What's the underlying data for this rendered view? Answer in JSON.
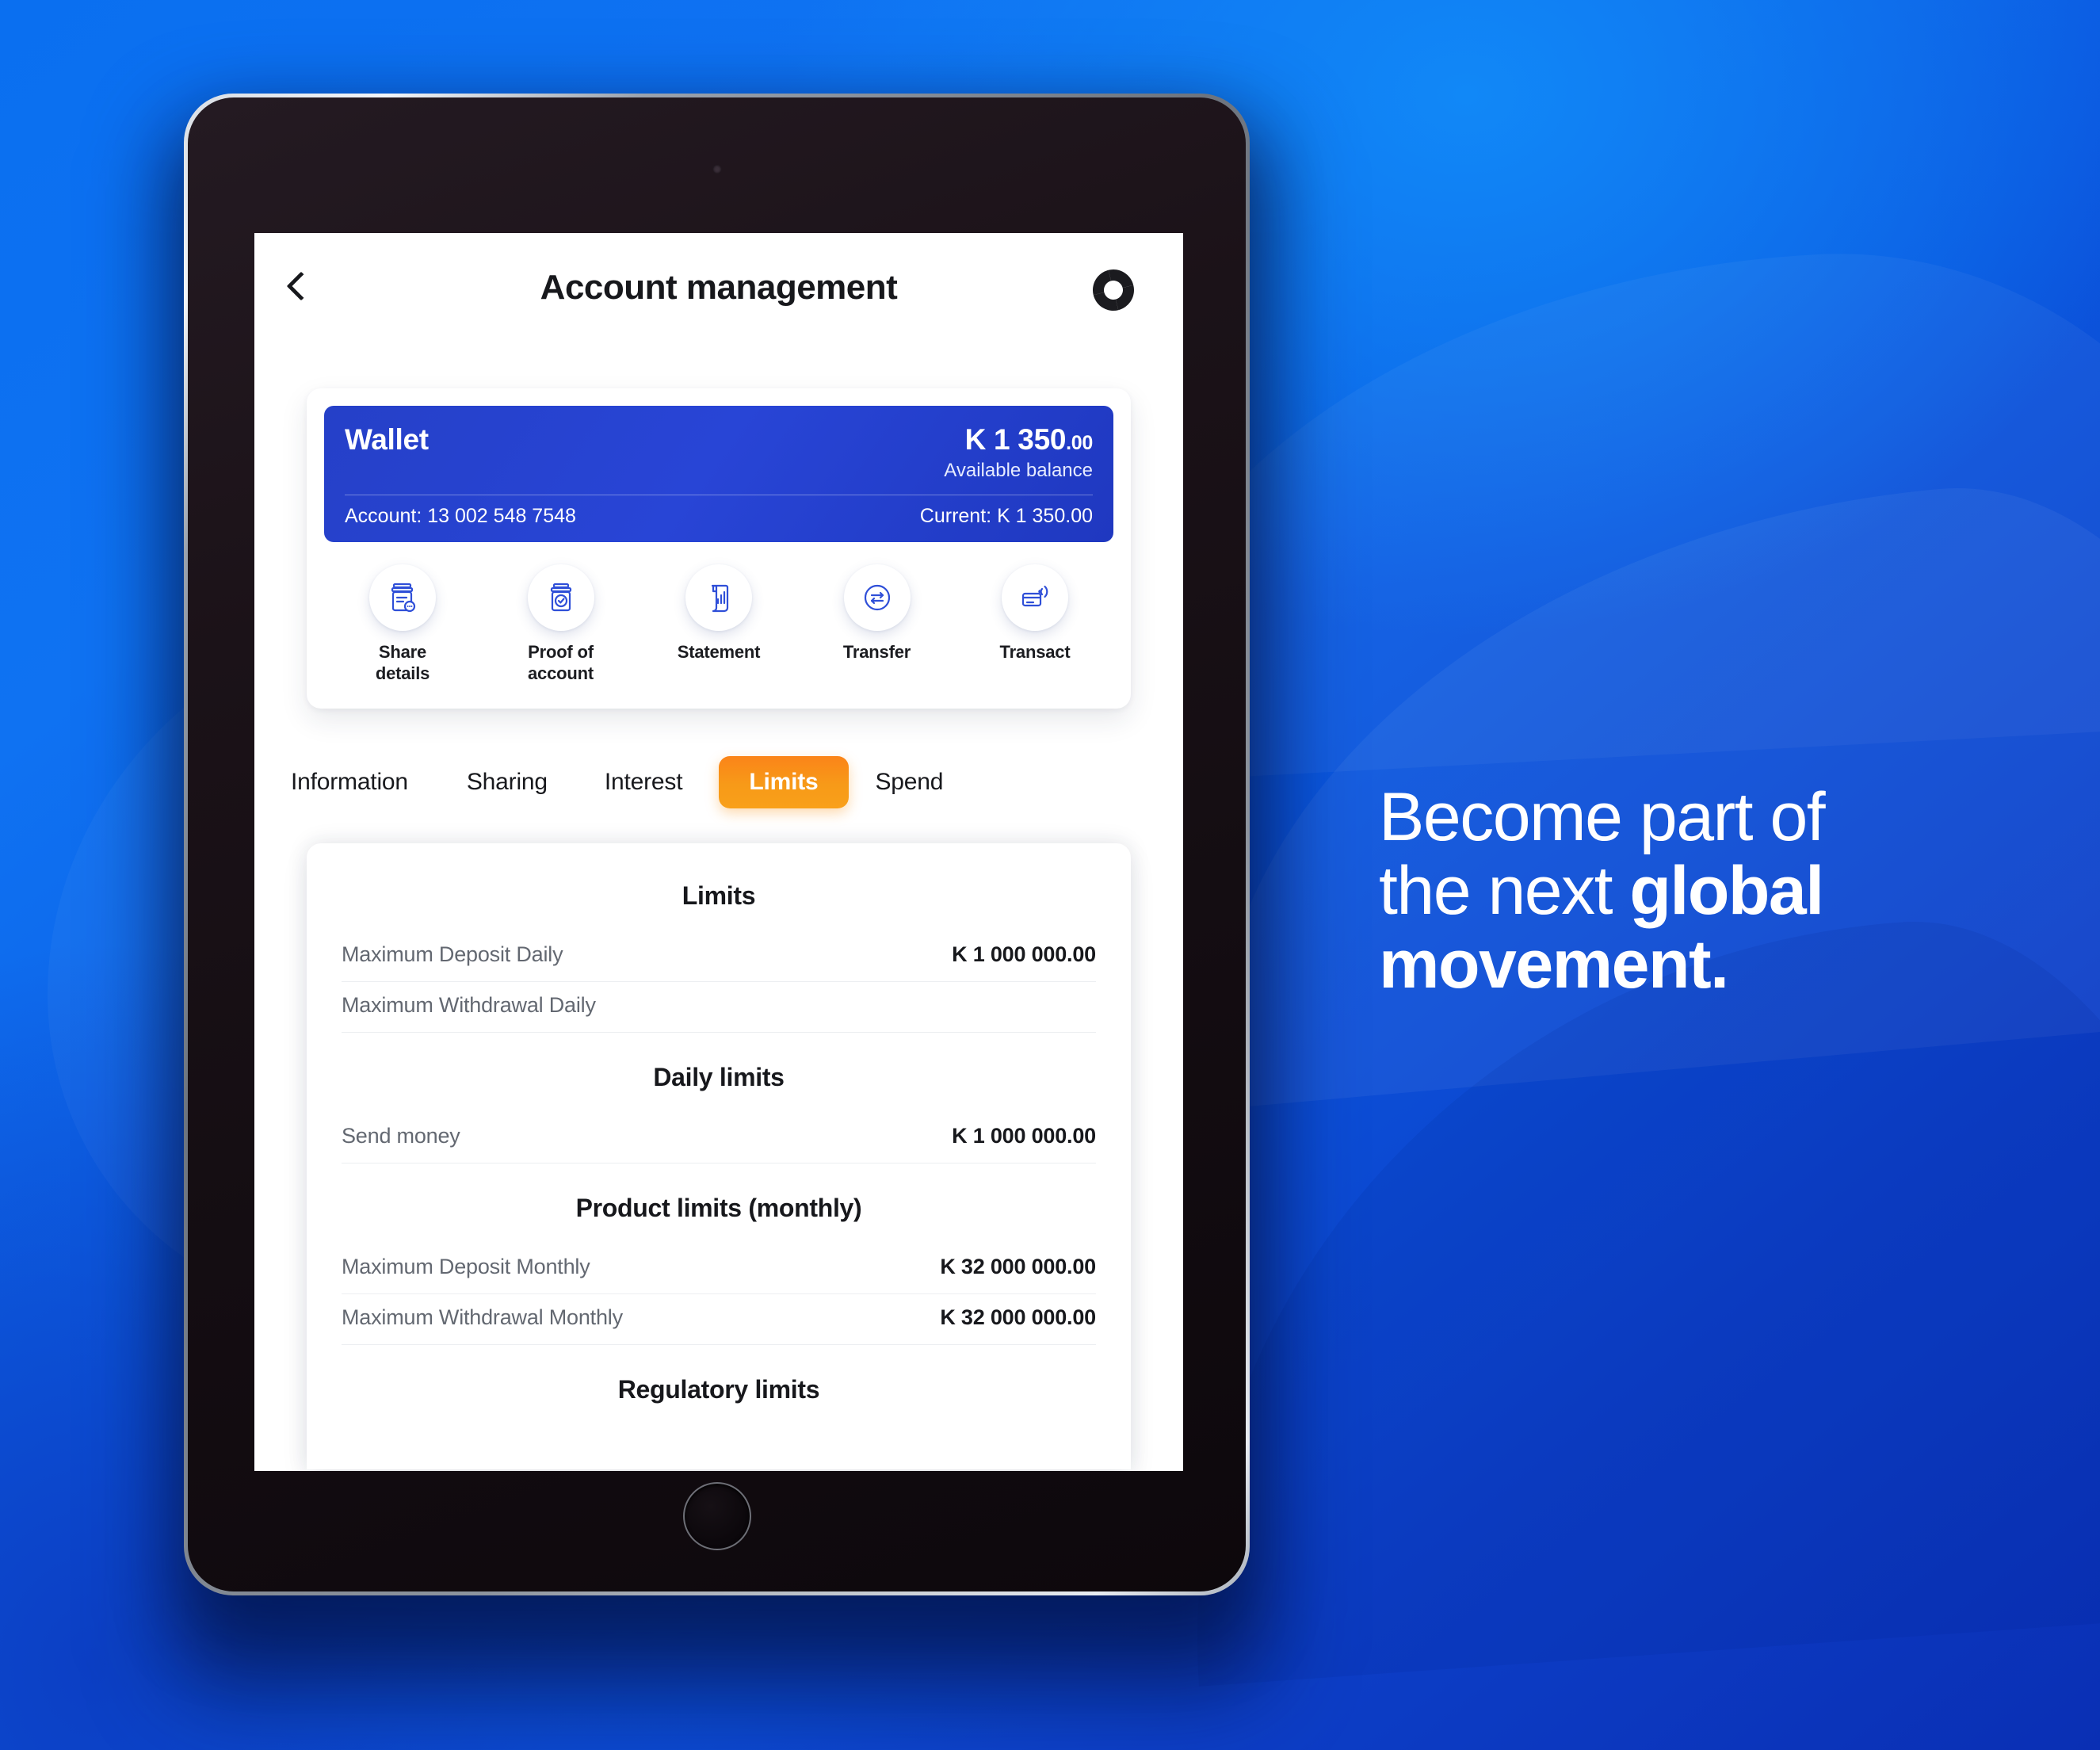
{
  "app": {
    "title": "Account management",
    "back_icon": "chevron-left-icon",
    "brand_icon": "ring-logo-icon"
  },
  "wallet": {
    "name": "Wallet",
    "amount_major": "K 1 350",
    "amount_cents": ".00",
    "available_label": "Available balance",
    "account_label": "Account:",
    "account_number": "13 002 548 7548",
    "current_label": "Current:",
    "current_value": "K 1 350.00"
  },
  "actions": [
    {
      "label": "Share\ndetails",
      "icon": "share-details-icon"
    },
    {
      "label": "Proof of\naccount",
      "icon": "proof-of-account-icon"
    },
    {
      "label": "Statement",
      "icon": "statement-icon"
    },
    {
      "label": "Transfer",
      "icon": "transfer-icon"
    },
    {
      "label": "Transact",
      "icon": "transact-card-icon"
    }
  ],
  "tabs": [
    {
      "label": "Information",
      "active": false
    },
    {
      "label": "Sharing",
      "active": false
    },
    {
      "label": "Interest",
      "active": false
    },
    {
      "label": "Limits",
      "active": true
    },
    {
      "label": "Spend",
      "active": false
    }
  ],
  "limits_panel": {
    "sections": [
      {
        "heading": "Limits",
        "rows": [
          {
            "label": "Maximum Deposit Daily",
            "value": "K 1 000 000.00"
          },
          {
            "label": "Maximum Withdrawal Daily",
            "value": ""
          }
        ]
      },
      {
        "heading": "Daily limits",
        "rows": [
          {
            "label": "Send money",
            "value": "K 1 000 000.00"
          }
        ]
      },
      {
        "heading": "Product limits (monthly)",
        "rows": [
          {
            "label": "Maximum Deposit Monthly",
            "value": "K 32 000 000.00"
          },
          {
            "label": "Maximum Withdrawal Monthly",
            "value": "K 32 000 000.00"
          }
        ]
      },
      {
        "heading": "Regulatory limits",
        "rows": []
      }
    ]
  },
  "marketing": {
    "line1": "Become part of",
    "line2_plain": "the next ",
    "line2_bold": "global",
    "line3_bold": "movement."
  },
  "colors": {
    "brand_blue": "#2845d6",
    "accent_orange": "#f9961a",
    "background_blue": "#0b58e0",
    "text_dark": "#17181c",
    "text_muted": "#636871"
  }
}
